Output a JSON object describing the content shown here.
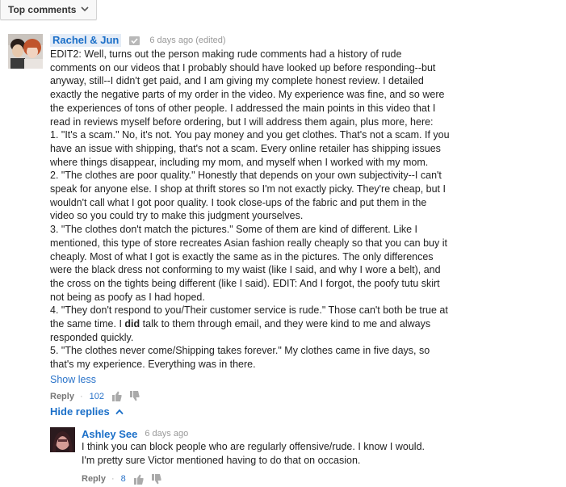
{
  "sort": {
    "label": "Top comments",
    "icon": "chevron-down-icon"
  },
  "comment": {
    "author": "Rachel & Jun",
    "time": "6 days ago (edited)",
    "paragraphs": [
      "EDIT2: Well, turns out the person making rude comments had a history of rude comments on our videos that I probably should have looked up before responding--but anyway, still--I didn't get paid, and I am giving my complete honest review. I detailed exactly the negative parts of my order in the video. My experience was fine, and so were the experiences of tons of other people. I addressed the main points in this video that I read in reviews myself before ordering, but I will address them again, plus more, here:",
      "1. \"It's a scam.\" No, it's not. You pay money and you get clothes. That's not a scam. If you have an issue with shipping, that's not a scam. Every online retailer has shipping issues where things disappear, including my mom, and myself when I worked with my mom.",
      "2. \"The clothes are poor quality.\" Honestly that depends on your own subjectivity--I can't speak for anyone else. I shop at thrift stores so I'm not exactly picky. They're cheap, but I wouldn't call what I got poor quality. I took close-ups of the fabric and put them in the video so you could try to make this judgment yourselves.",
      "3. \"The clothes don't match the pictures.\" Some of them are kind of different. Like I mentioned, this type of store recreates Asian fashion really cheaply so that you can buy it cheaply. Most of what I got is exactly the same as in the pictures. The only differences were the black dress not conforming to my waist (like I said, and why I wore a belt), and the cross on the tights being different (like I said). EDIT: And I forgot, the poofy tutu skirt not being as poofy as I had hoped.",
      "4. \"They don't respond to you/Their customer service is rude.\" Those can't both be true at the same time. I",
      "did",
      "talk to them through email, and they were kind to me and always responded quickly.",
      "5. \"The clothes never come/Shipping takes forever.\" My clothes came in five days, so that's my experience. Everything was in there."
    ],
    "show_less": "Show less",
    "reply_label": "Reply",
    "separator": "·",
    "likes": "102"
  },
  "hide_replies": "Hide replies",
  "reply": {
    "author": "Ashley See",
    "time": "6 days ago",
    "text": "I think you can block people who are regularly offensive/rude. I know I would. I'm pretty sure Victor mentioned having to do that on occasion.",
    "reply_label": "Reply",
    "separator": "·",
    "likes": "8"
  }
}
